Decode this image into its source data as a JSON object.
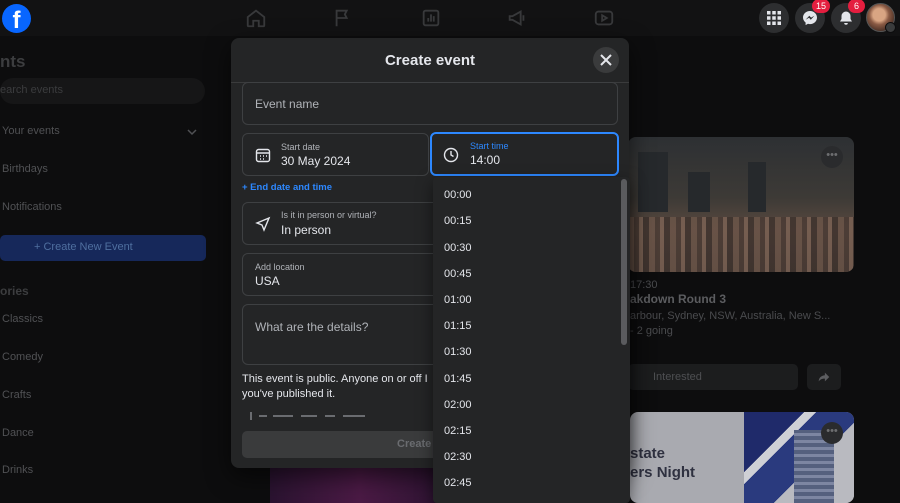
{
  "sidebar": {
    "title": "nts",
    "search_placeholder": "earch events",
    "items": [
      "Your events",
      "Birthdays",
      "Notifications"
    ],
    "create_label": "+ Create New Event",
    "categories_title": "ories",
    "categories": [
      "Classics",
      "Comedy",
      "Crafts",
      "Dance",
      "Drinks"
    ]
  },
  "nav": {
    "messenger_badge": "15",
    "notifications_badge": "6"
  },
  "background_cards": {
    "time": "17:30",
    "name": "akdown Round 3",
    "location": "arbour, Sydney, NSW, Australia, New S...",
    "going": "- 2 going",
    "interested_label": "Interested",
    "card2_line1": "state",
    "card2_line2": "ers Night"
  },
  "modal": {
    "title": "Create event",
    "event_name_placeholder": "Event name",
    "start_date_label": "Start date",
    "start_date_value": "30 May 2024",
    "start_time_label": "Start time",
    "start_time_value": "14:00",
    "end_link": "+ End date and time",
    "location_type_label": "Is it in person or virtual?",
    "location_type_value": "In person",
    "add_location_label": "Add location",
    "add_location_value": "USA",
    "details_placeholder": "What are the details?",
    "public_text": "This event is public. Anyone on or off I you've published it.",
    "create_button": "Create"
  },
  "dropdown": {
    "times": [
      "00:00",
      "00:15",
      "00:30",
      "00:45",
      "01:00",
      "01:15",
      "01:30",
      "01:45",
      "02:00",
      "02:15",
      "02:30",
      "02:45"
    ]
  },
  "colors": {
    "accent": "#2d88ff",
    "brand": "#0866ff",
    "badge": "#e41e3f"
  }
}
